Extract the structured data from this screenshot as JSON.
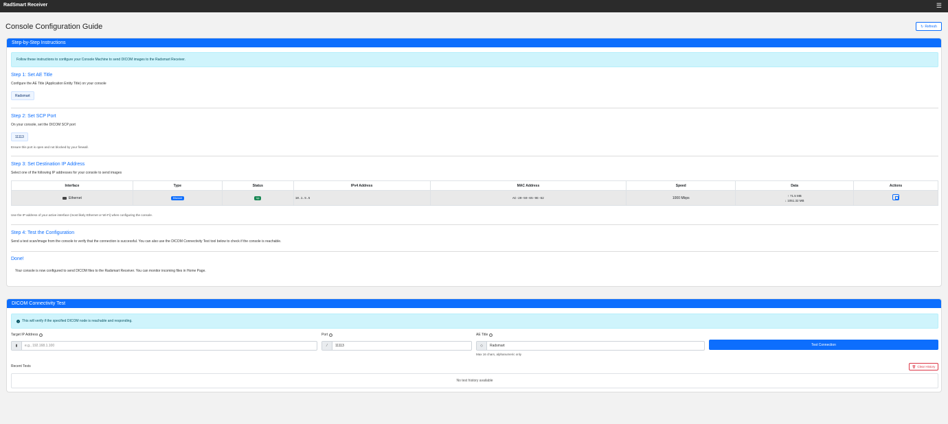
{
  "app": {
    "title": "RadSmart Receiver",
    "menu_icon": "hamburger-icon"
  },
  "page": {
    "title": "Console Configuration Guide",
    "refresh_label": "Refresh"
  },
  "instructions": {
    "header": "Step-by-Step Instructions",
    "alert": "Follow these instructions to configure your Console Machine to send DICOM images to the Radsmart Receiver.",
    "step1": {
      "title": "Step 1: Set AE Title",
      "desc": "Configure the AE Title (Application Entity Title) on your console",
      "value": "Radsmart"
    },
    "step2": {
      "title": "Step 2: Set SCP Port",
      "desc": "On your console, set the DICOM SCP port",
      "value": "11113",
      "note": "Ensure this port is open and not blocked by your firewall."
    },
    "step3": {
      "title": "Step 3: Set Destination IP Address",
      "desc": "Select one of the following IP addresses for your console to send images",
      "columns": [
        "Interface",
        "Type",
        "Status",
        "IPv4 Address",
        "MAC Address",
        "Speed",
        "Data",
        "Actions"
      ],
      "rows": [
        {
          "interface": "Ethernet",
          "type": "Ethernet",
          "status": "Up",
          "ipv4": "10.1.5.5",
          "mac": "AC-20-59-65-9E-62",
          "speed": "1000 Mbps",
          "data_up": "↑ 71.5 MB",
          "data_down": "↓ 1051.32 MB"
        }
      ],
      "note": "Use the IP address of your active interface (most likely Ethernet or Wi-Fi) when configuring the console."
    },
    "step4": {
      "title": "Step 4: Test the Configuration",
      "desc": "Send a test scan/image from the console to verify that the connection is successful. You can also use the DICOM Connectivity Test tool below to check if the console is reachable."
    },
    "done": {
      "title": "Done!",
      "desc": "Your console is now configured to send DICOM files to the Radsmart Receiver. You can monitor incoming files in Home Page."
    }
  },
  "connectivity": {
    "header": "DICOM Connectivity Test",
    "alert": "This will verify if the specified DICOM node is reachable and responding.",
    "target_ip": {
      "label": "Target IP Address",
      "placeholder": "e.g., 192.168.1.100"
    },
    "port": {
      "label": "Port",
      "value": "11113"
    },
    "ae_title": {
      "label": "AE Title",
      "value": "Radsmart",
      "hint": "Max 16 chars, alphanumeric only"
    },
    "test_button": "Test Connection",
    "recent_label": "Recent Tests",
    "clear_label": "Clear History",
    "empty_text": "No test history available"
  }
}
